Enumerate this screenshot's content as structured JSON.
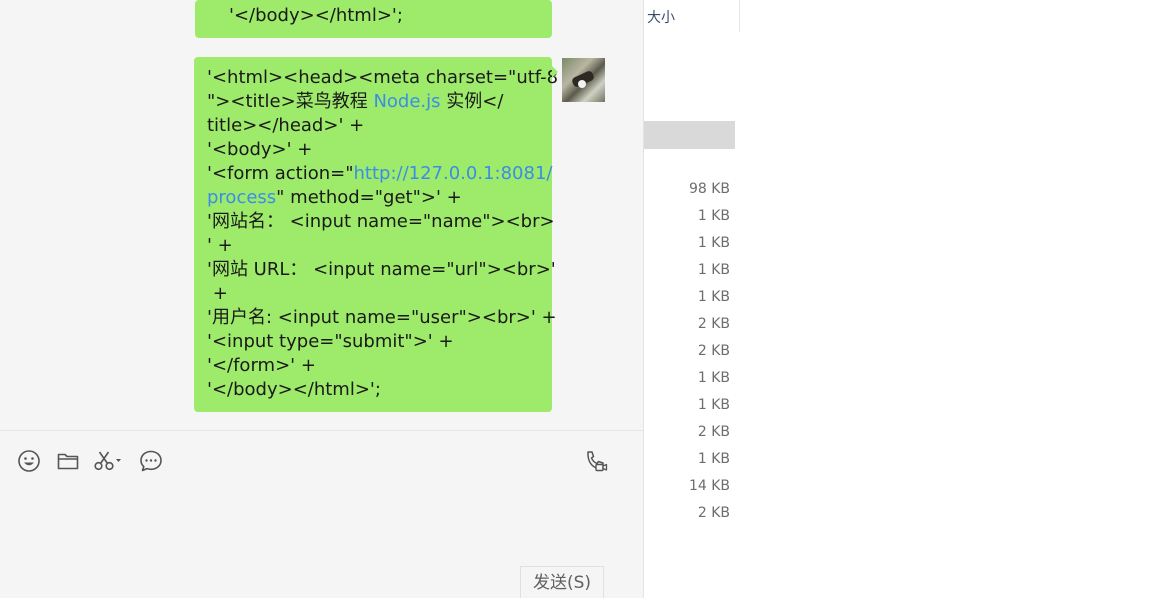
{
  "chat": {
    "prev_message_tail": "'</body></html>';",
    "message_lines": [
      {
        "pre": "'<html><head><meta charset=\"utf-8",
        "link": "",
        "post": ""
      },
      {
        "pre": "\"><title>菜鸟教程 ",
        "link": "Node.js",
        "post": " 实例</"
      },
      {
        "pre": "title></head>' +",
        "link": "",
        "post": ""
      },
      {
        "pre": "'<body>' +",
        "link": "",
        "post": ""
      },
      {
        "pre": "'<form action=\"",
        "link": "http://127.0.0.1:8081/",
        "post": ""
      },
      {
        "pre": "",
        "link": "process",
        "post": "\" method=\"get\">' +"
      },
      {
        "pre": "'网站名： <input name=\"name\"><br>",
        "link": "",
        "post": ""
      },
      {
        "pre": "' +",
        "link": "",
        "post": ""
      },
      {
        "pre": "'网站 URL： <input name=\"url\"><br>'",
        "link": "",
        "post": ""
      },
      {
        "pre": " +",
        "link": "",
        "post": ""
      },
      {
        "pre": "'用户名: <input name=\"user\"><br>' +",
        "link": "",
        "post": ""
      },
      {
        "pre": "'<input type=\"submit\">' +",
        "link": "",
        "post": ""
      },
      {
        "pre": "'</form>' +",
        "link": "",
        "post": ""
      },
      {
        "pre": "'</body></html>';",
        "link": "",
        "post": ""
      }
    ],
    "toolbar": {
      "icons": [
        "emoji-icon",
        "folder-icon",
        "scissors-icon",
        "chat-bubble-icon",
        "video-call-icon"
      ]
    },
    "send_label": "发送(S)"
  },
  "files": {
    "size_header": "大小",
    "sizes": [
      "98 KB",
      "1 KB",
      "1 KB",
      "1 KB",
      "1 KB",
      "2 KB",
      "2 KB",
      "1 KB",
      "1 KB",
      "2 KB",
      "1 KB",
      "14 KB",
      "2 KB"
    ]
  },
  "colors": {
    "bubble": "#9eea6a",
    "link": "#3a8ee6",
    "chat_bg": "#f5f5f5"
  }
}
